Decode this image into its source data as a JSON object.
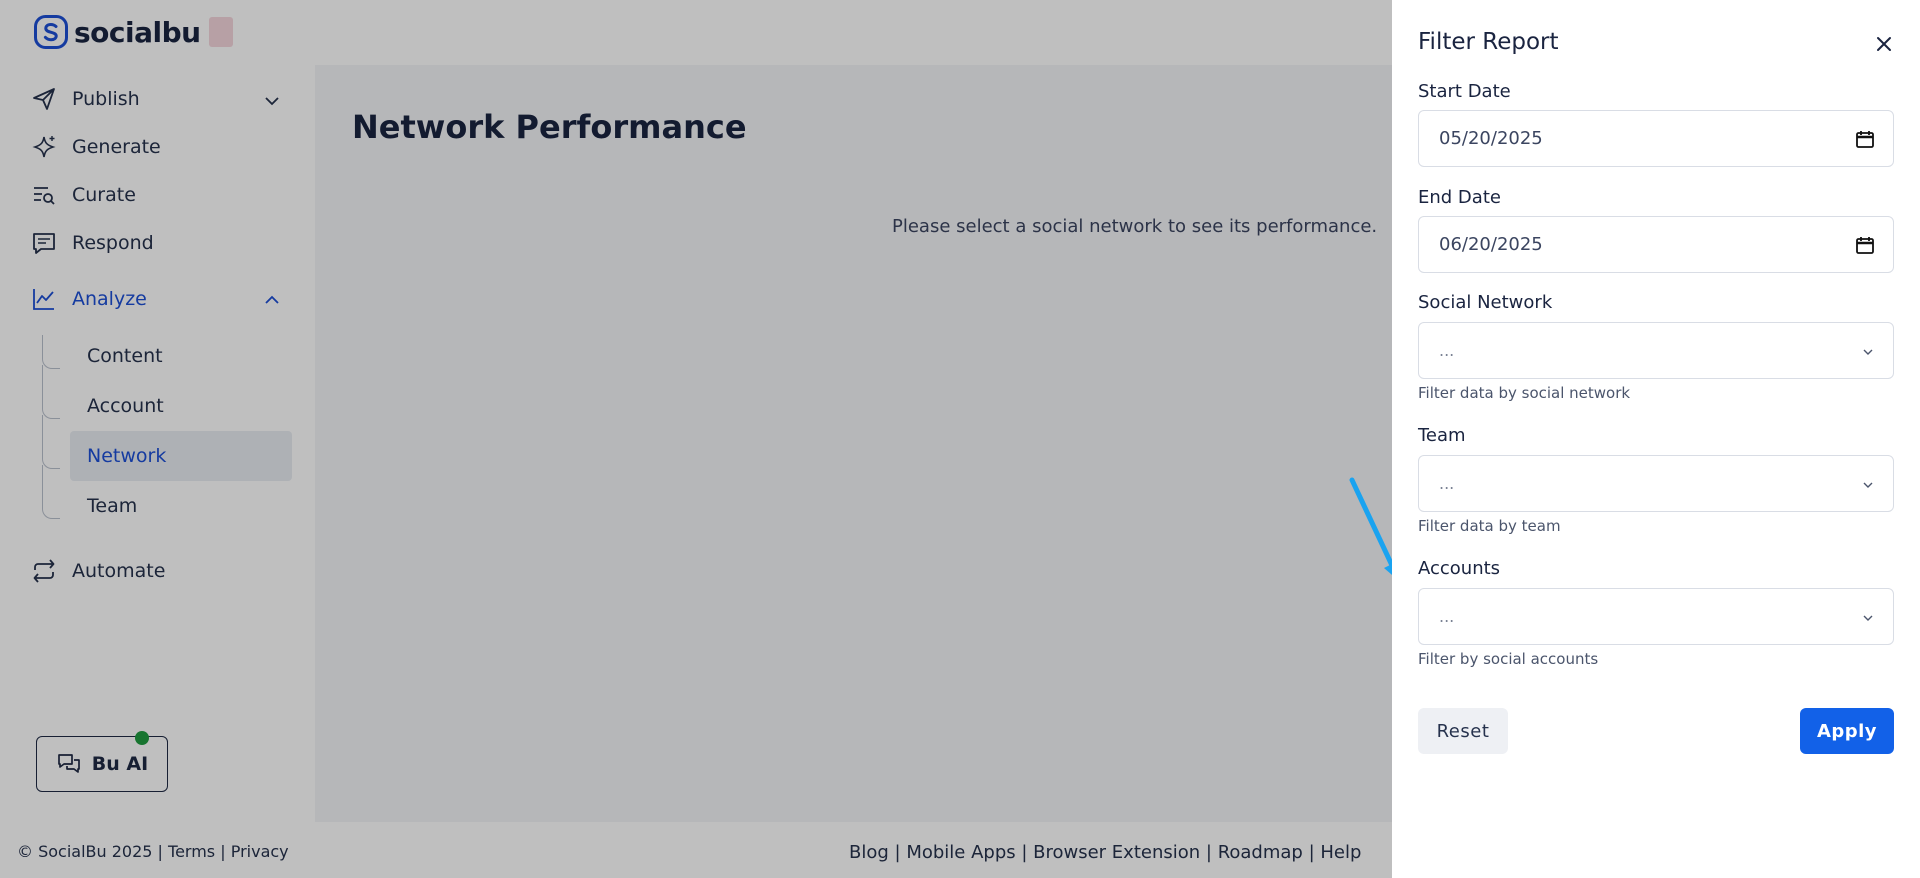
{
  "brand": {
    "name": "socialbu"
  },
  "sidebar": {
    "items": [
      {
        "label": "Publish",
        "icon": "send-icon"
      },
      {
        "label": "Generate",
        "icon": "sparkle-icon"
      },
      {
        "label": "Curate",
        "icon": "list-search-icon"
      },
      {
        "label": "Respond",
        "icon": "message-icon"
      },
      {
        "label": "Analyze",
        "icon": "chart-line-icon"
      },
      {
        "label": "Automate",
        "icon": "repeat-icon"
      }
    ],
    "analyze_sub": [
      "Content",
      "Account",
      "Network",
      "Team"
    ],
    "active_sub": "Network",
    "bu_ai_label": "Bu AI"
  },
  "main": {
    "title": "Network Performance",
    "empty_message": "Please select a social network to see its performance."
  },
  "footer": {
    "copyright": "© SocialBu 2025",
    "terms": "Terms",
    "privacy": "Privacy",
    "links": [
      "Blog",
      "Mobile Apps",
      "Browser Extension",
      "Roadmap",
      "Help"
    ]
  },
  "filter_panel": {
    "title": "Filter Report",
    "start_date_label": "Start Date",
    "start_date_value": "05/20/2025",
    "end_date_label": "End Date",
    "end_date_value": "06/20/2025",
    "social_network_label": "Social Network",
    "social_network_value": "...",
    "social_network_help": "Filter data by social network",
    "team_label": "Team",
    "team_value": "...",
    "team_help": "Filter data by team",
    "accounts_label": "Accounts",
    "accounts_value": "...",
    "accounts_help": "Filter by social accounts",
    "reset_label": "Reset",
    "apply_label": "Apply"
  },
  "colors": {
    "accent": "#1261e8",
    "active_nav": "#1c4fd6",
    "annotation_arrow": "#1aa3f0",
    "status_dot": "#1f9b3f"
  }
}
